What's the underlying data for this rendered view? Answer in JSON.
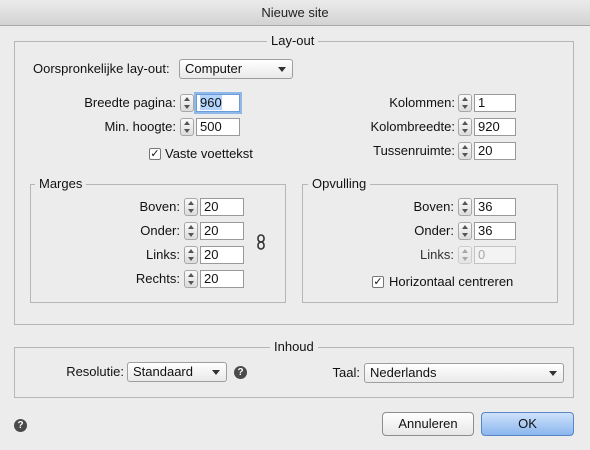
{
  "window": {
    "title": "Nieuwe site"
  },
  "layout": {
    "legend": "Lay-out",
    "original_layout_label": "Oorspronkelijke lay-out:",
    "original_layout_value": "Computer",
    "page_width_label": "Breedte pagina:",
    "page_width_value": "960",
    "min_height_label": "Min. hoogte:",
    "min_height_value": "500",
    "fixed_footer_label": "Vaste voettekst",
    "fixed_footer_checked": "✓",
    "columns_label": "Kolommen:",
    "columns_value": "1",
    "column_width_label": "Kolombreedte:",
    "column_width_value": "920",
    "gutter_label": "Tussenruimte:",
    "gutter_value": "20"
  },
  "margins": {
    "legend": "Marges",
    "top_label": "Boven:",
    "top_value": "20",
    "bottom_label": "Onder:",
    "bottom_value": "20",
    "left_label": "Links:",
    "left_value": "20",
    "right_label": "Rechts:",
    "right_value": "20"
  },
  "padding": {
    "legend": "Opvulling",
    "top_label": "Boven:",
    "top_value": "36",
    "bottom_label": "Onder:",
    "bottom_value": "36",
    "left_label": "Links:",
    "left_value": "0",
    "center_label": "Horizontaal centreren",
    "center_checked": "✓"
  },
  "content": {
    "legend": "Inhoud",
    "resolution_label": "Resolutie:",
    "resolution_value": "Standaard",
    "language_label": "Taal:",
    "language_value": "Nederlands"
  },
  "buttons": {
    "cancel": "Annuleren",
    "ok": "OK"
  },
  "help_glyph": "?",
  "icons": {
    "link": "link-icon",
    "help": "help-icon"
  }
}
